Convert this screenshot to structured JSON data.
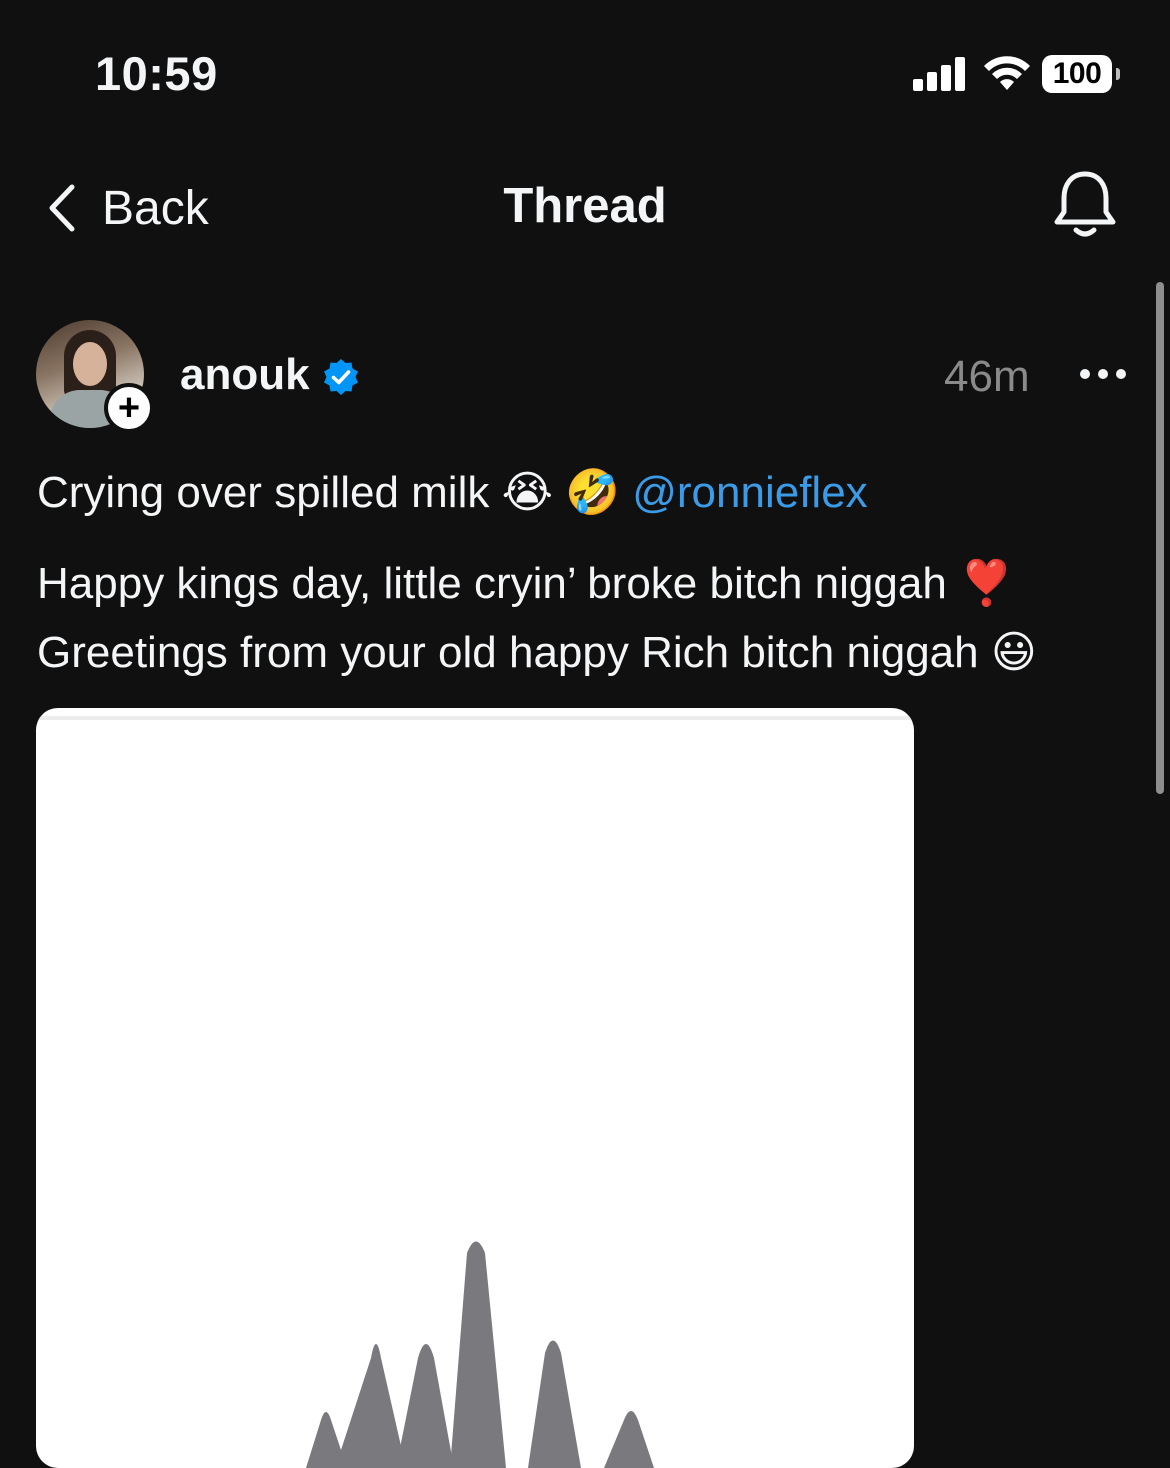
{
  "status_bar": {
    "time": "10:59",
    "battery": "100",
    "icons": [
      "signal-icon",
      "wifi-icon",
      "battery-icon"
    ]
  },
  "nav": {
    "back_label": "Back",
    "title": "Thread",
    "right_icon": "bell-icon"
  },
  "post": {
    "username": "anouk",
    "verified": true,
    "timestamp": "46m",
    "line1_text": "Crying over spilled milk 😭 🤣 ",
    "mention": "@ronnieflex",
    "line2": "Happy kings day, little cryin’ broke bitch niggah ❣️",
    "line3": "Greetings from your old happy Rich bitch niggah 😃"
  },
  "colors": {
    "background": "#101010",
    "text": "#f3f5f7",
    "muted": "#8a8a8a",
    "link": "#3b9be6",
    "verified": "#0095f6",
    "waveform": "#7a7a7e"
  }
}
